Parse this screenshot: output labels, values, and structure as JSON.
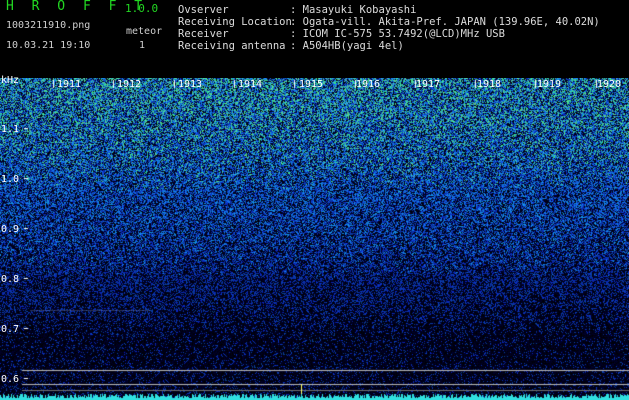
{
  "header": {
    "app_title": "H R O F F T",
    "version": "1.0.0",
    "file_name": "1003211910.png",
    "timestamp": "10.03.21 19:10",
    "meteor_label": "meteor",
    "meteor_count": "1"
  },
  "info": [
    {
      "label": "Ovserver",
      "value": ": Masayuki Kobayashi"
    },
    {
      "label": "Receiving Location",
      "value": ": Ogata-vill. Akita-Pref. JAPAN (139.96E, 40.02N)"
    },
    {
      "label": "Receiver",
      "value": ": ICOM IC-575 53.7492(@LCD)MHz USB"
    },
    {
      "label": "Receiving antenna",
      "value": ": A504HB(yagi 4el)"
    }
  ],
  "axis": {
    "y_unit": "kHz",
    "y_ticks": [
      "1.1",
      "1.0",
      "0.9",
      "0.8",
      "0.7",
      "0.6"
    ],
    "x_ticks": [
      "1911",
      "1912",
      "1913",
      "1914",
      "1915",
      "1916",
      "1917",
      "1918",
      "1919",
      "1920"
    ]
  },
  "colors": {
    "title_green": "#22d822",
    "noise_low": "#000030",
    "noise_mid": "#1040c0",
    "noise_high": "#30c8a0",
    "baseline": "#30e0e0"
  }
}
